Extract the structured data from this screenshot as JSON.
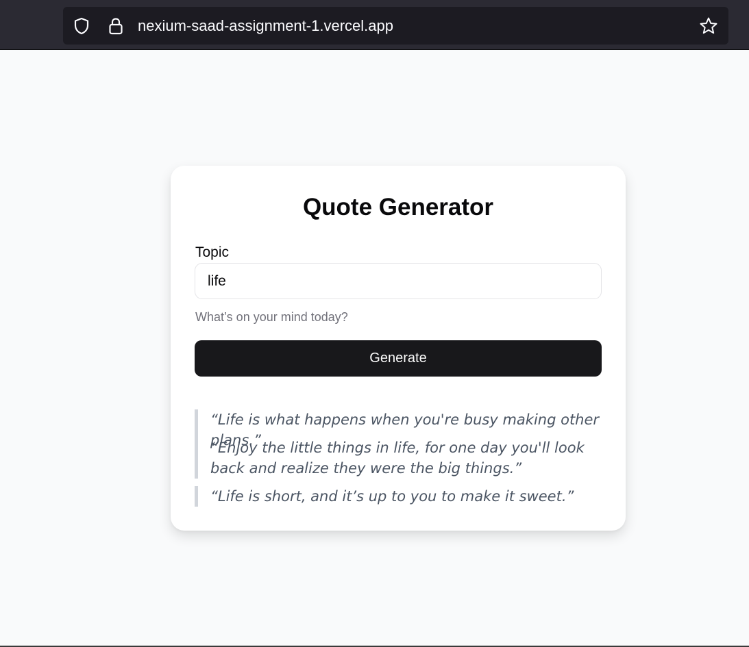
{
  "browser": {
    "url": "nexium-saad-assignment-1.vercel.app"
  },
  "page": {
    "title": "Quote Generator",
    "topic_label": "Topic",
    "topic_value": "life",
    "hint": "What’s on your mind today?",
    "generate_label": "Generate"
  },
  "quotes": [
    "“Life is what happens when you're busy making other plans.”",
    "“Enjoy the little things in life, for one day you'll look back and realize they were the big things.”",
    "“Life is short, and it’s up to you to make it sweet.”"
  ],
  "icons": [
    "shield-icon",
    "lock-icon",
    "star-icon"
  ]
}
